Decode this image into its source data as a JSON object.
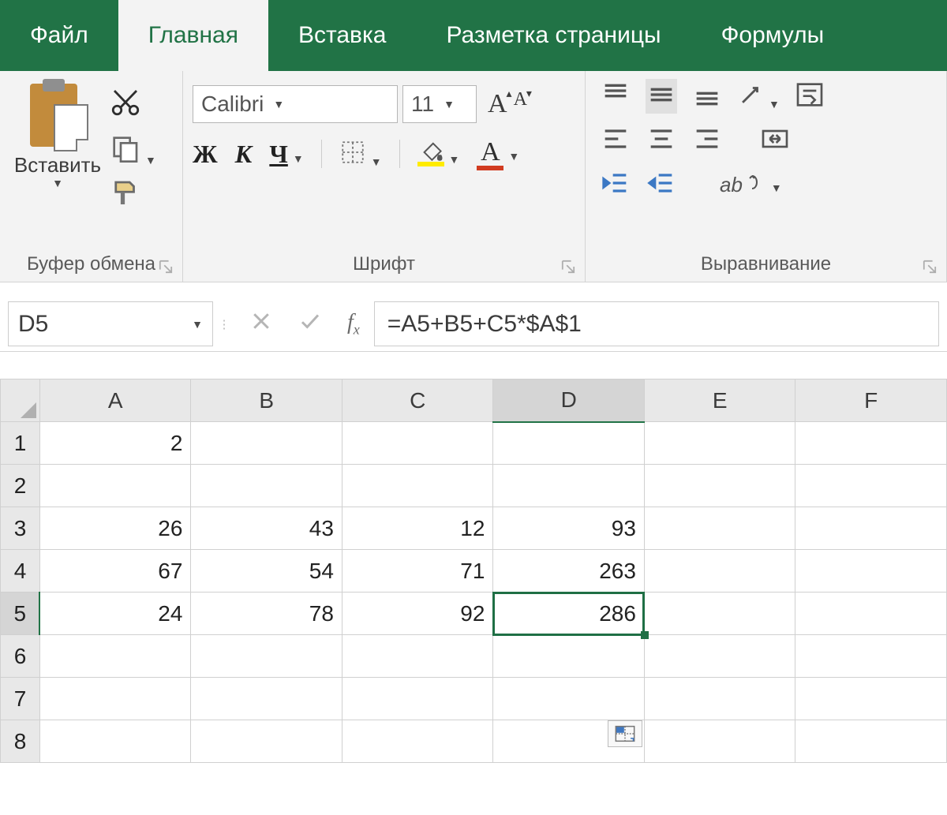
{
  "tabs": {
    "file": "Файл",
    "home": "Главная",
    "insert": "Вставка",
    "layout": "Разметка страницы",
    "formulas": "Формулы"
  },
  "ribbon": {
    "clipboard": {
      "paste": "Вставить",
      "label": "Буфер обмена"
    },
    "font": {
      "name": "Calibri",
      "size": "11",
      "bold": "Ж",
      "italic": "К",
      "underline": "Ч",
      "label": "Шрифт"
    },
    "align": {
      "label": "Выравнивание"
    }
  },
  "namebox": "D5",
  "formula": "=A5+B5+C5*$A$1",
  "columns": [
    "A",
    "B",
    "C",
    "D",
    "E",
    "F"
  ],
  "rows": [
    "1",
    "2",
    "3",
    "4",
    "5",
    "6",
    "7",
    "8"
  ],
  "selected_col": "D",
  "selected_row": "5",
  "cells": {
    "A1": "2",
    "A3": "26",
    "A4": "67",
    "A5": "24",
    "B3": "43",
    "B4": "54",
    "B5": "78",
    "C3": "12",
    "C4": "71",
    "C5": "92",
    "D3": "93",
    "D4": "263",
    "D5": "286"
  }
}
